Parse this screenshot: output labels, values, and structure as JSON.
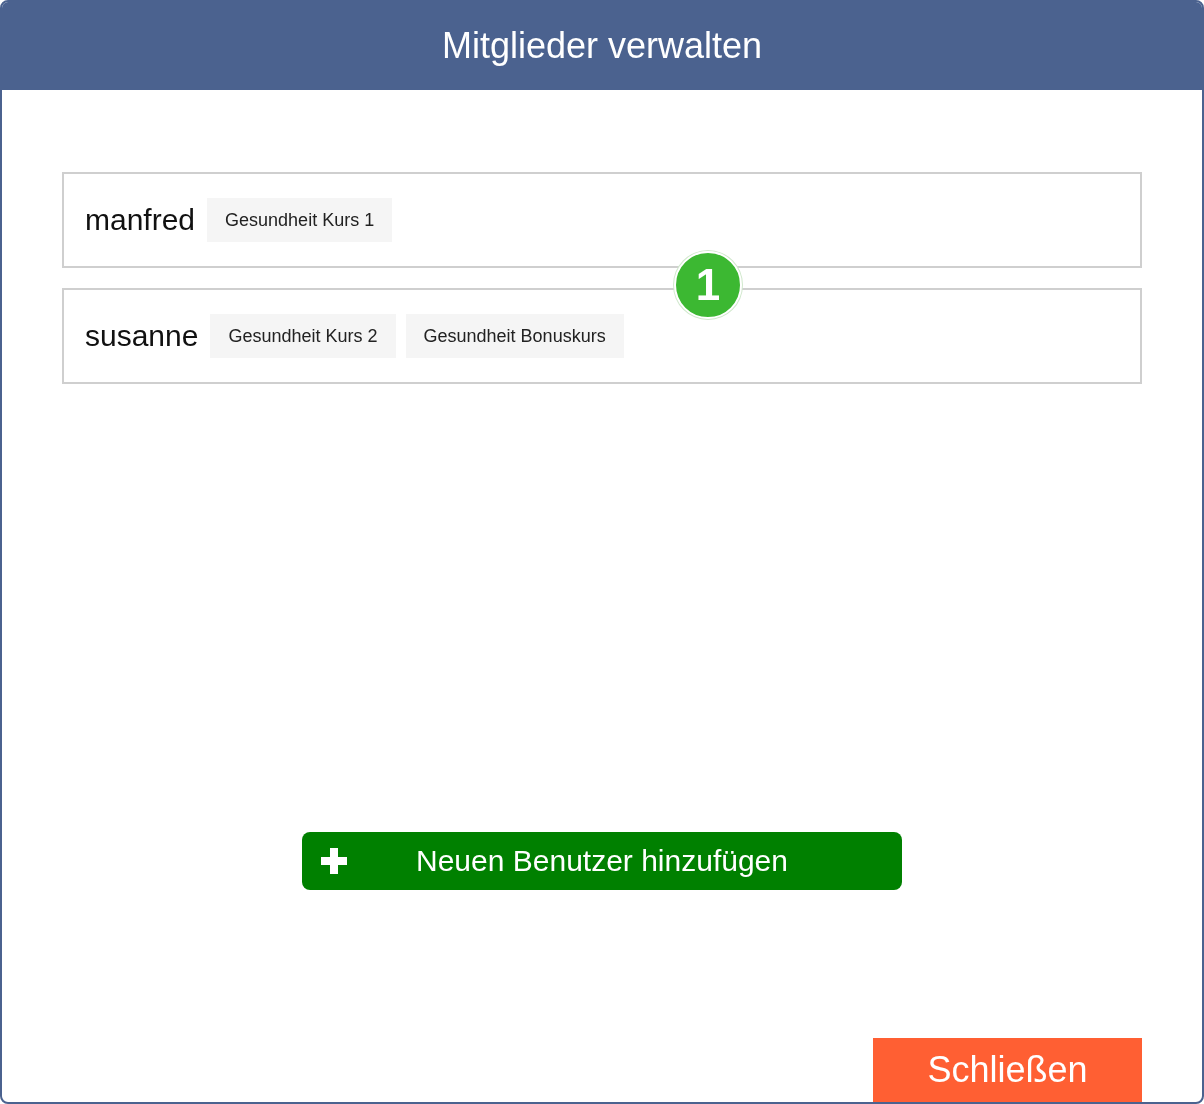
{
  "window": {
    "title": "Mitglieder verwalten"
  },
  "members": [
    {
      "name": "manfred",
      "courses": [
        "Gesundheit Kurs 1"
      ]
    },
    {
      "name": "susanne",
      "courses": [
        "Gesundheit Kurs 2",
        "Gesundheit Bonuskurs"
      ]
    }
  ],
  "callout": {
    "label": "1"
  },
  "add_button": {
    "label": "Neuen Benutzer hinzufügen"
  },
  "close_button": {
    "label": "Schließen"
  }
}
